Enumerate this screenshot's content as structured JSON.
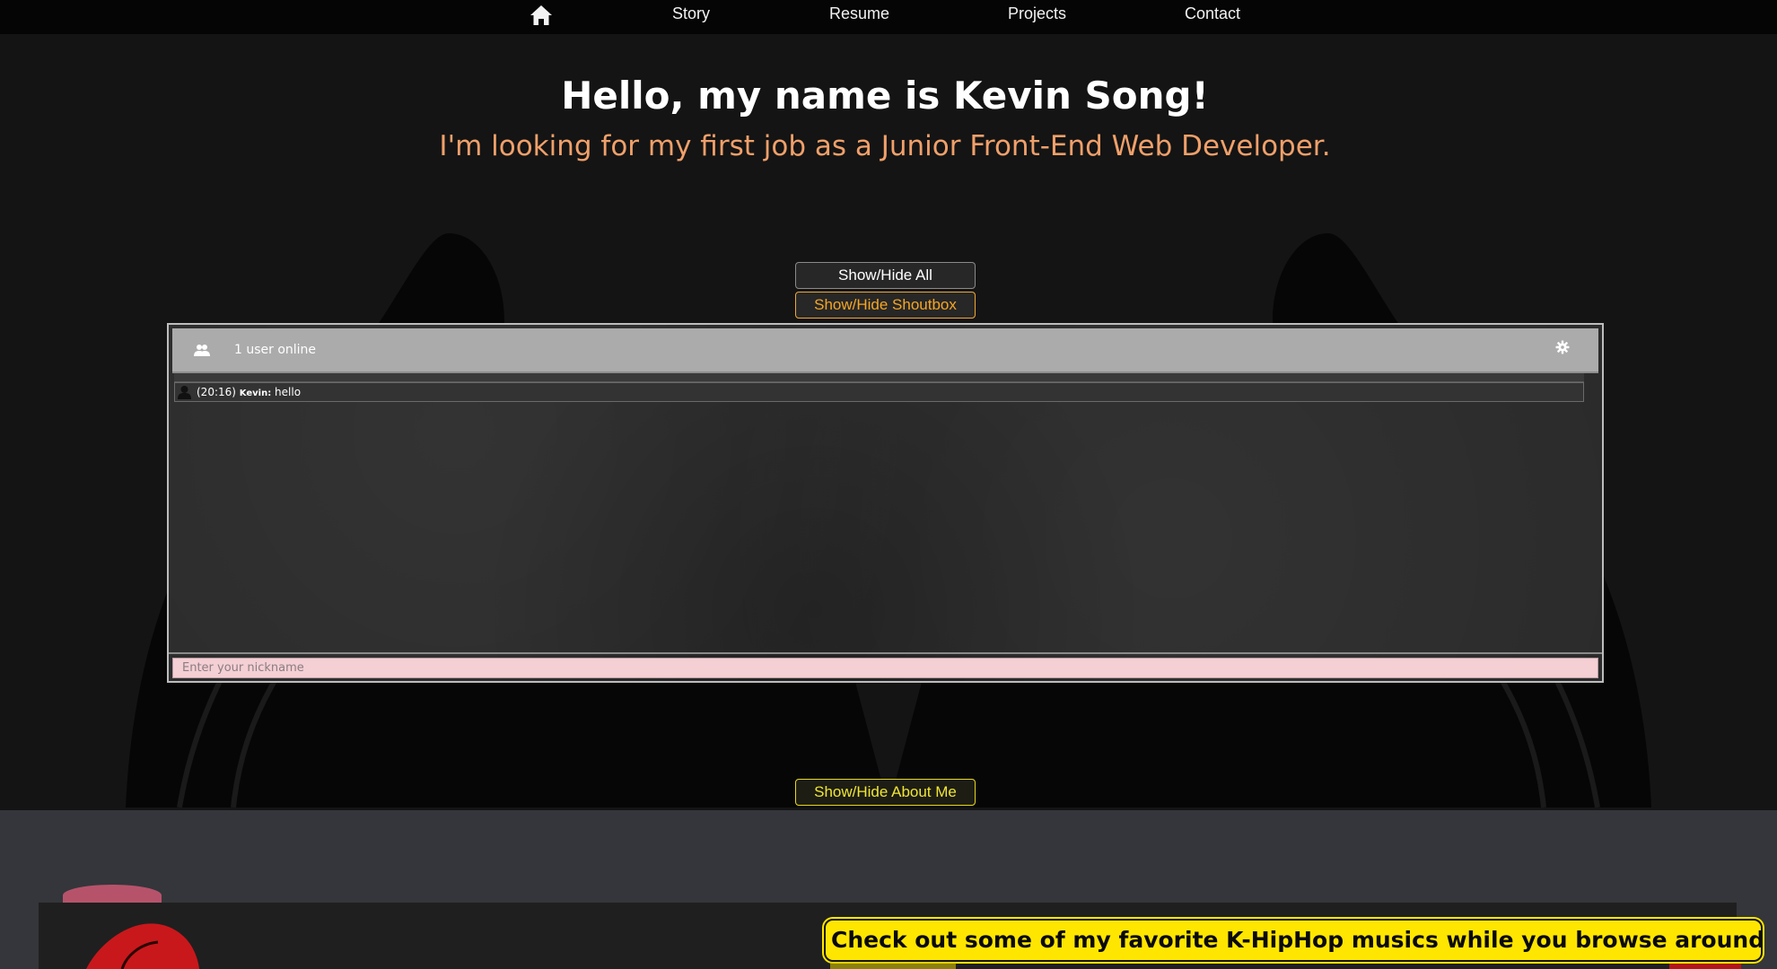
{
  "nav": {
    "home_icon": "home-icon",
    "items": [
      "Story",
      "Resume",
      "Projects",
      "Contact"
    ]
  },
  "hero": {
    "title": "Hello, my name is Kevin Song!",
    "subtitle": "I'm looking for my first job as a Junior Front-End Web Developer."
  },
  "buttons": {
    "show_hide_all": "Show/Hide All",
    "show_hide_shoutbox": "Show/Hide Shoutbox",
    "show_hide_about": "Show/Hide About Me"
  },
  "shoutbox": {
    "users_icon": "users-icon",
    "users_online": "1 user online",
    "settings_icon": "gear-icon",
    "messages": [
      {
        "time": "(20:16)",
        "user": "Kevin:",
        "text": "hello"
      }
    ],
    "nickname_placeholder": "Enter your nickname"
  },
  "banner": {
    "text": "Check out some of my favorite K-HipHop musics while you browse around!",
    "arrow": "→"
  },
  "colors": {
    "accent_orange": "#f6a623",
    "subtitle_orange": "#f0a06a",
    "accent_yellow": "#f0e634",
    "banner_yellow": "#ffe600",
    "input_pink": "#f4cfd4"
  }
}
